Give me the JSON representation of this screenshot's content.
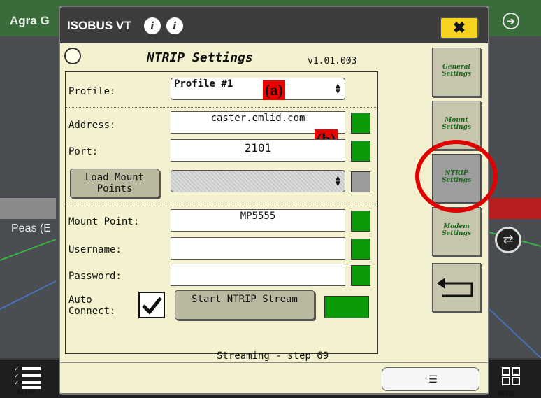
{
  "background": {
    "app_label": "Agra G",
    "crop_label": "Peas (E",
    "setup_label": "SETUP",
    "menu_label": "MENU"
  },
  "dialog": {
    "title": "ISOBUS VT",
    "close_glyph": "✖",
    "heading": "NTRIP Settings",
    "version": "v1.01.003"
  },
  "form": {
    "profile_label": "Profile:",
    "profile_value": "Profile #1",
    "address_label": "Address:",
    "address_value": "caster.emlid.com",
    "port_label": "Port:",
    "port_value": "2101",
    "load_mount_label": "Load Mount Points",
    "mount_point_label": "Mount Point:",
    "mount_point_value": "MP5555",
    "username_label": "Username:",
    "username_value": "",
    "password_label": "Password:",
    "password_value": "",
    "auto_connect_label": "Auto Connect:",
    "auto_connect_checked": true,
    "start_button_label": "Start NTRIP Stream",
    "status_text": "Streaming - step 69"
  },
  "annotations": {
    "a": "(a)",
    "b": "(b)"
  },
  "side_tabs": [
    {
      "label": "General Settings"
    },
    {
      "label": "Mount Settings"
    },
    {
      "label": "NTRIP Settings",
      "active": true
    },
    {
      "label": "Modem Settings"
    }
  ],
  "colors": {
    "status_ok": "#0a9a0a",
    "status_idle": "#9b9b9b",
    "highlight_ring": "#e00000",
    "close_button": "#f5d31f"
  }
}
